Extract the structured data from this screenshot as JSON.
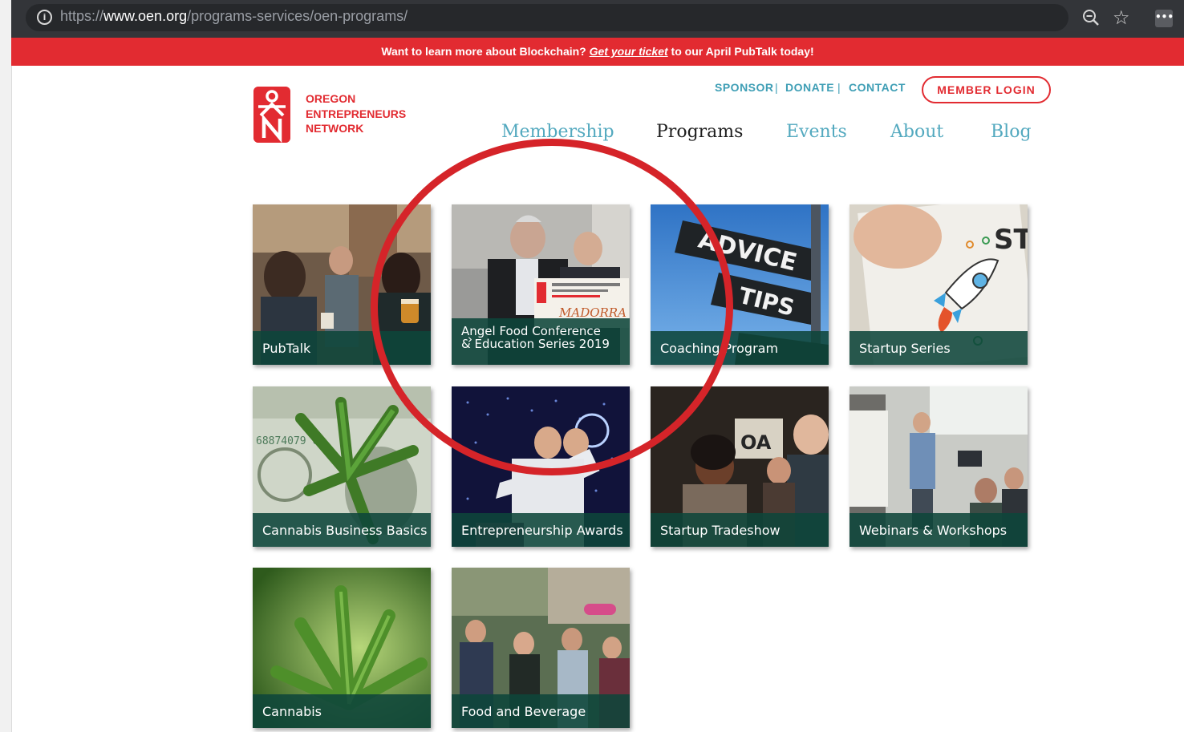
{
  "browser": {
    "url_scheme": "https://",
    "url_domain": "www.oen.org",
    "url_path": "/programs-services/oen-programs/",
    "info_icon": "info-icon",
    "zoom_icon": "zoom-icon",
    "bookmark_icon": "star-icon",
    "menu_icon": "more-icon"
  },
  "banner": {
    "prefix": "Want to learn more about Blockchain? ",
    "link": "Get your ticket",
    "suffix": " to our April PubTalk today!",
    "color": "#e22b31"
  },
  "logo": {
    "line1": "OREGON",
    "line2": "ENTREPRENEURS",
    "line3": "NETWORK"
  },
  "utility_nav": {
    "sponsor": "SPONSOR",
    "donate": "DONATE",
    "contact": "CONTACT",
    "separator": "|",
    "login": "MEMBER LOGIN"
  },
  "main_nav": {
    "items": [
      "Membership",
      "Programs",
      "Events",
      "About",
      "Blog"
    ],
    "active": "Programs"
  },
  "programs": [
    {
      "title": "PubTalk"
    },
    {
      "title": "Angel Food Conference & Education Series 2019"
    },
    {
      "title": "Coaching Program"
    },
    {
      "title": "Startup Series"
    },
    {
      "title": "Cannabis Business Basics"
    },
    {
      "title": "Entrepreneurship Awards"
    },
    {
      "title": "Startup Tradeshow"
    },
    {
      "title": "Webinars & Workshops"
    },
    {
      "title": "Cannabis"
    },
    {
      "title": "Food and Beverage"
    }
  ],
  "photo_text": {
    "advice": "ADVICE",
    "tips": "TIPS",
    "bill_serial": "68874079 Q",
    "certificate": "MADORRA",
    "tradeshow_sign": "OA"
  },
  "colors": {
    "accent_red": "#e22b31",
    "nav_teal": "#53a9bf",
    "tile_label_green": "#0e463a",
    "annotation_ring": "#d52429"
  }
}
